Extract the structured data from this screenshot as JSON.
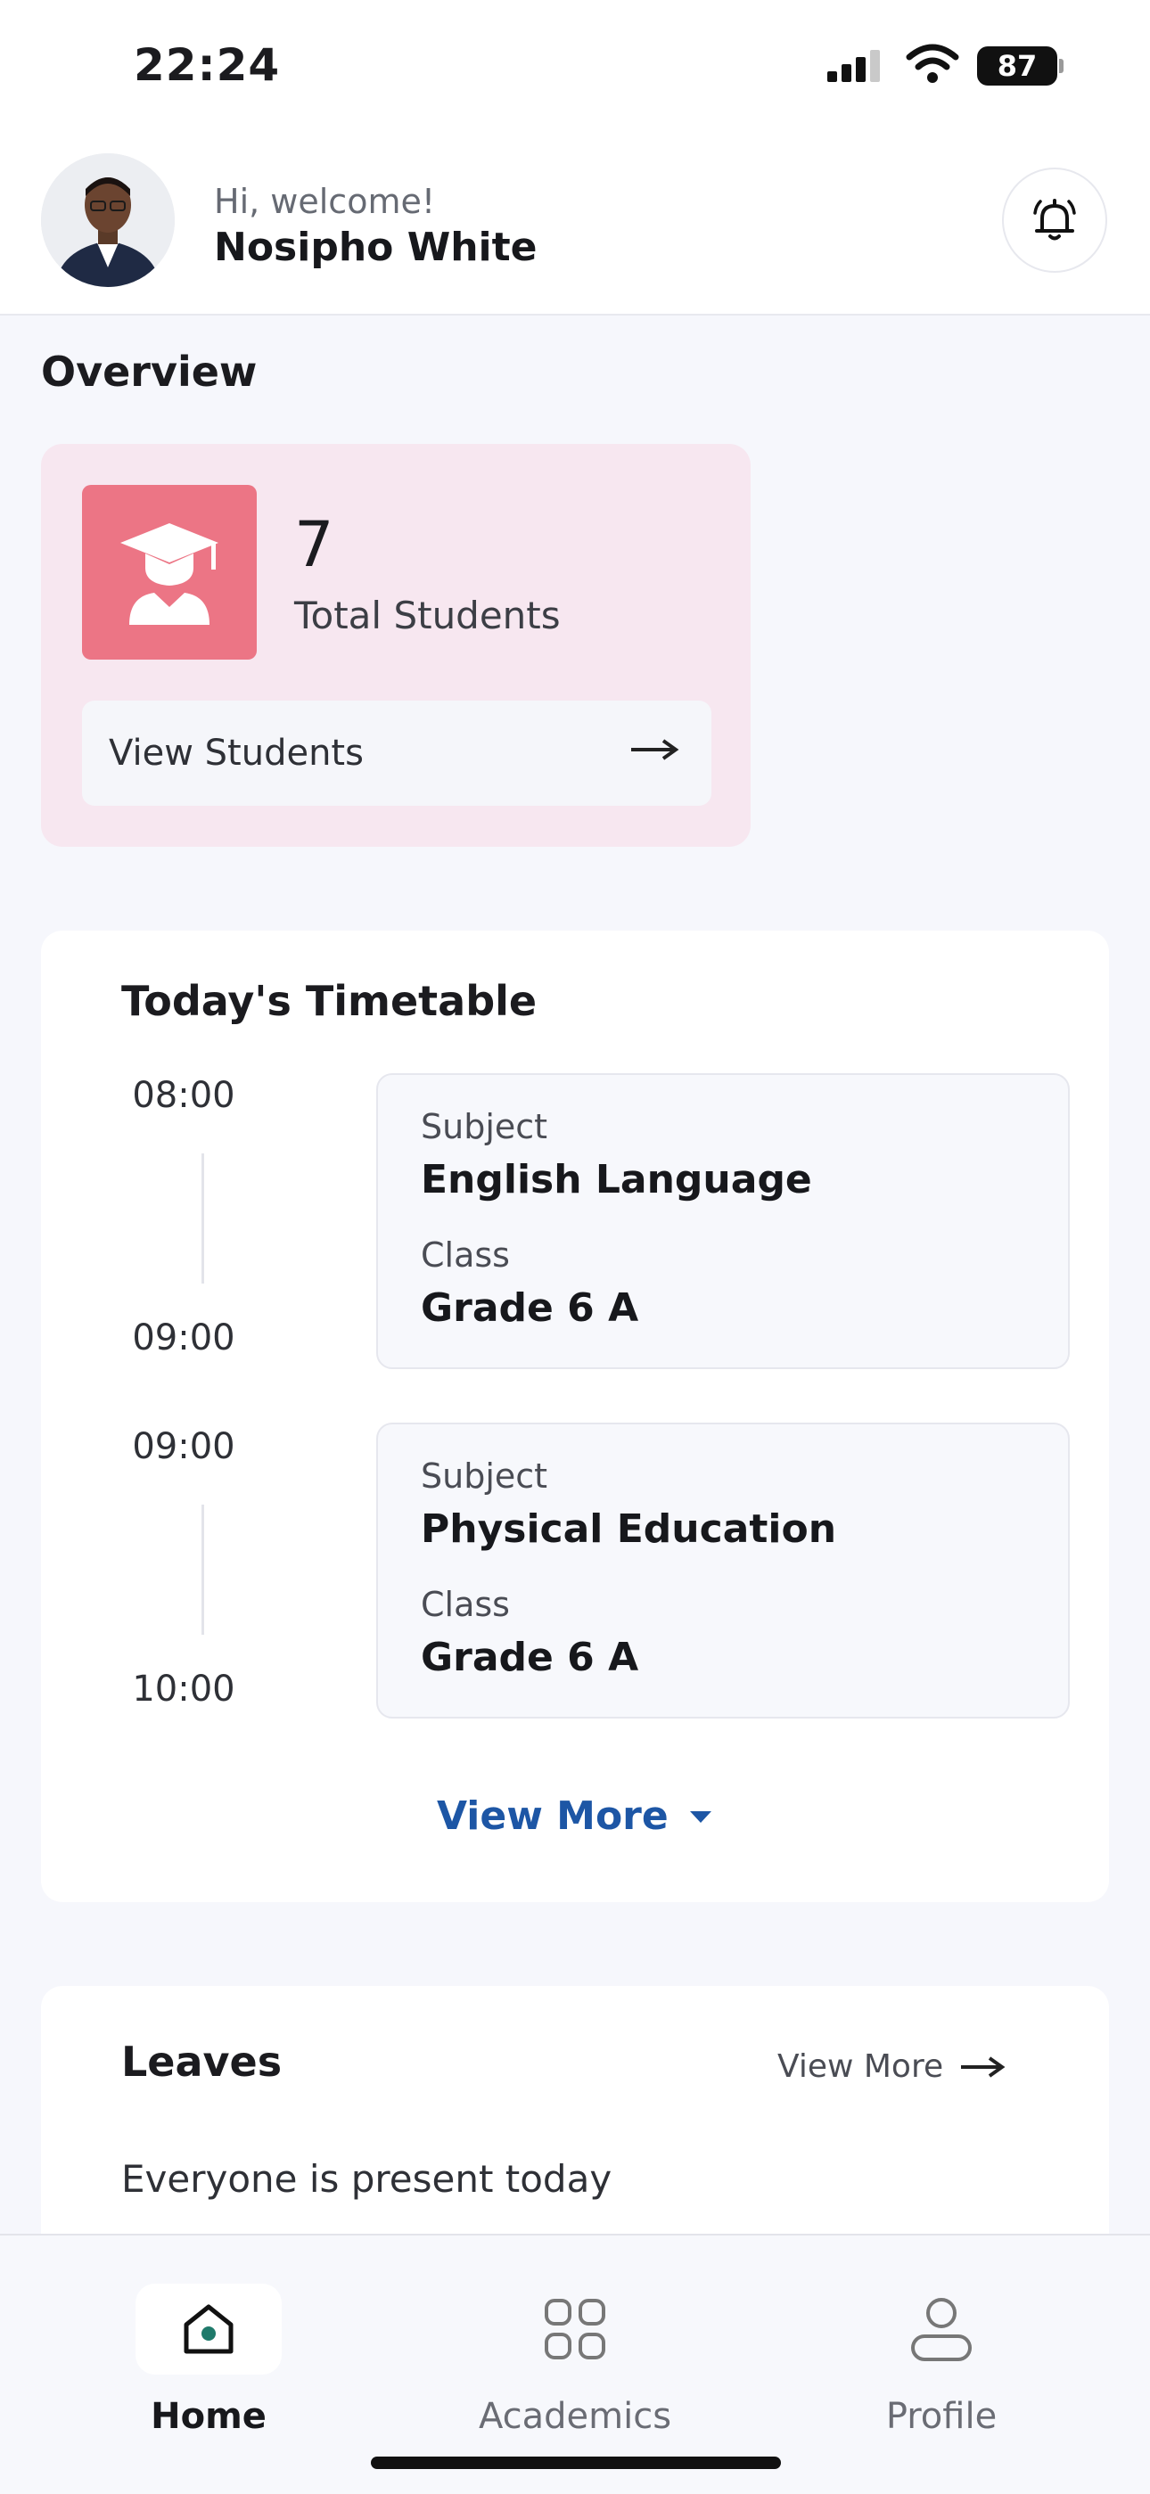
{
  "status_bar": {
    "time": "22:24",
    "battery": "87"
  },
  "header": {
    "greeting": "Hi, welcome!",
    "user_name": "Nosipho White"
  },
  "overview": {
    "title": "Overview",
    "total_students_value": "7",
    "total_students_label": "Total Students",
    "view_students_label": "View Students"
  },
  "timetable": {
    "title": "Today's Timetable",
    "slots": [
      {
        "start": "08:00",
        "end": "09:00",
        "subject_label": "Subject",
        "subject": "English Language",
        "class_label": "Class",
        "class": "Grade 6 A"
      },
      {
        "start": "09:00",
        "end": "10:00",
        "subject_label": "Subject",
        "subject": "Physical Education",
        "class_label": "Class",
        "class": "Grade 6 A"
      }
    ],
    "view_more": "View More"
  },
  "leaves": {
    "title": "Leaves",
    "view_more": "View More",
    "status": "Everyone is present today"
  },
  "nav": {
    "items": [
      {
        "label": "Home"
      },
      {
        "label": "Academics"
      },
      {
        "label": "Profile"
      }
    ],
    "active": "Home"
  },
  "colors": {
    "accent": "#1d56a5",
    "student_tile": "#ec7585",
    "overview_bg": "#f7e7f0",
    "home_icon_dot": "#1f7a6b"
  }
}
